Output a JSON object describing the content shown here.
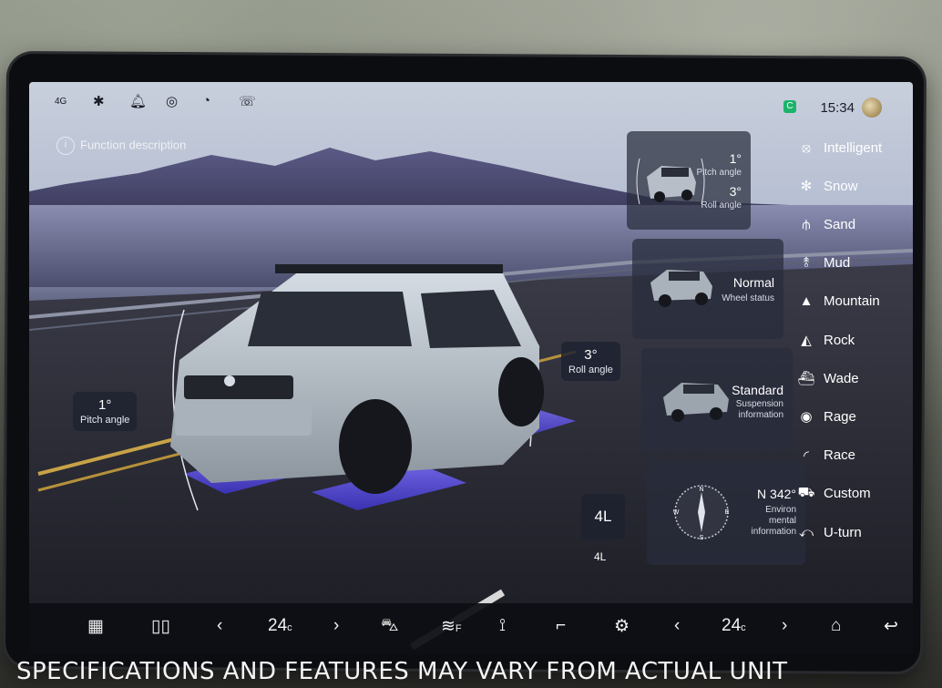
{
  "status_bar": {
    "signal": "4G",
    "icons": [
      "signal-icon",
      "bluetooth-icon",
      "bell-icon",
      "location-icon",
      "speedometer-icon",
      "call-icon"
    ],
    "time": "15:34"
  },
  "function_description": "Function description",
  "pitch_tag": {
    "value": "1°",
    "label": "Pitch angle"
  },
  "roll_tag": {
    "value": "3°",
    "label": "Roll angle"
  },
  "cards": {
    "attitude": {
      "pitch_value": "1°",
      "pitch_label": "Pitch angle",
      "roll_value": "3°",
      "roll_label": "Roll angle"
    },
    "wheel": {
      "value": "Normal",
      "label": "Wheel status"
    },
    "suspension": {
      "value": "Standard",
      "label": "Suspension information"
    },
    "environment": {
      "value": "N 342°",
      "label": "Environ mental information",
      "compass": {
        "n": "N",
        "e": "E",
        "s": "S",
        "w": "W"
      }
    }
  },
  "drive_mode": {
    "value": "4L",
    "label": "4L"
  },
  "modes": [
    {
      "label": "Intelligent",
      "icon": "intelligent-icon",
      "glyph": "⦻"
    },
    {
      "label": "Snow",
      "icon": "snow-icon",
      "glyph": "✻"
    },
    {
      "label": "Sand",
      "icon": "sand-icon",
      "glyph": "⫛"
    },
    {
      "label": "Mud",
      "icon": "mud-icon",
      "glyph": "⥉"
    },
    {
      "label": "Mountain",
      "icon": "mountain-icon",
      "glyph": "▲"
    },
    {
      "label": "Rock",
      "icon": "rock-icon",
      "glyph": "◭"
    },
    {
      "label": "Wade",
      "icon": "wade-icon",
      "glyph": "⛴"
    },
    {
      "label": "Rage",
      "icon": "rage-icon",
      "glyph": "◉"
    },
    {
      "label": "Race",
      "icon": "race-icon",
      "glyph": "◜"
    },
    {
      "label": "Custom",
      "icon": "custom-icon",
      "glyph": "⛟"
    },
    {
      "label": "U-turn",
      "icon": "u-turn-icon",
      "glyph": "⤺"
    }
  ],
  "dock": {
    "left_temp": "24",
    "right_temp": "24",
    "temp_unit": "c",
    "defrost_label": "F"
  },
  "disclaimer": "SPECIFICATIONS AND FEATURES MAY VARY FROM ACTUAL UNIT"
}
